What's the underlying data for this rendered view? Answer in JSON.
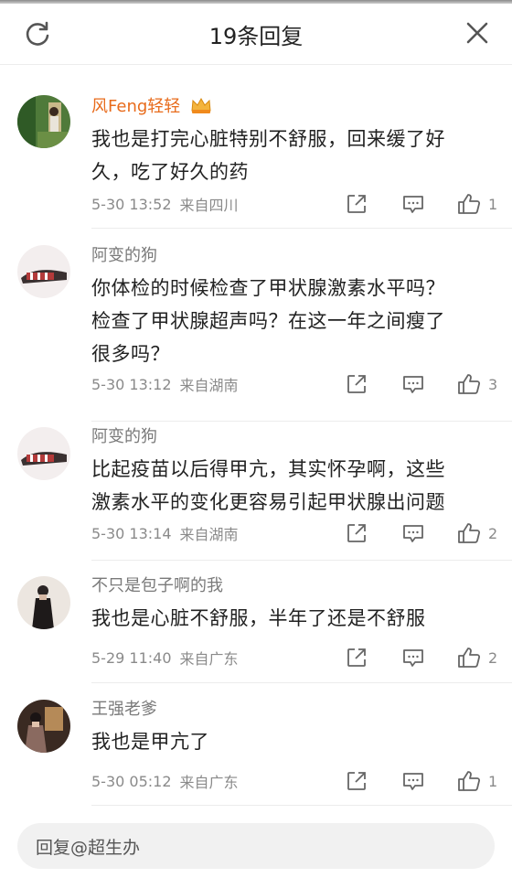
{
  "header": {
    "title": "19条回复",
    "refresh_icon": "refresh-icon",
    "close_icon": "close-icon"
  },
  "comments": [
    {
      "username": "风Feng轻轻",
      "vip": true,
      "text_lines": [
        "我也是打完心脏特别不舒服，回来缓了好",
        "久，吃了好久的药"
      ],
      "time": "5-30 13:52",
      "source": "来自四川",
      "likes": "1"
    },
    {
      "username": "阿变的狗",
      "vip": false,
      "text_lines": [
        "你体检的时候检查了甲状腺激素水平吗？",
        "检查了甲状腺超声吗？在这一年之间瘦了",
        "很多吗？"
      ],
      "time": "5-30 13:12",
      "source": "来自湖南",
      "likes": "3"
    },
    {
      "username": "阿变的狗",
      "vip": false,
      "text_lines": [
        "比起疫苗以后得甲亢，其实怀孕啊，这些",
        "激素水平的变化更容易引起甲状腺出问题"
      ],
      "time": "5-30 13:14",
      "source": "来自湖南",
      "likes": "2"
    },
    {
      "username": "不只是包子啊的我",
      "vip": false,
      "text_lines": [
        "我也是心脏不舒服，半年了还是不舒服"
      ],
      "time": "5-29 11:40",
      "source": "来自广东",
      "likes": "2"
    },
    {
      "username": "王强老爹",
      "vip": false,
      "text_lines": [
        "我也是甲亢了"
      ],
      "time": "5-30 05:12",
      "source": "来自广东",
      "likes": "1"
    }
  ],
  "reply_bar": {
    "placeholder": "回复@超生办"
  },
  "colors": {
    "vip_name": "#e86b1b",
    "username": "#7a7a7a",
    "meta": "#8a8a8a",
    "divider": "#ececec",
    "reply_bg": "#f1f1f1"
  }
}
